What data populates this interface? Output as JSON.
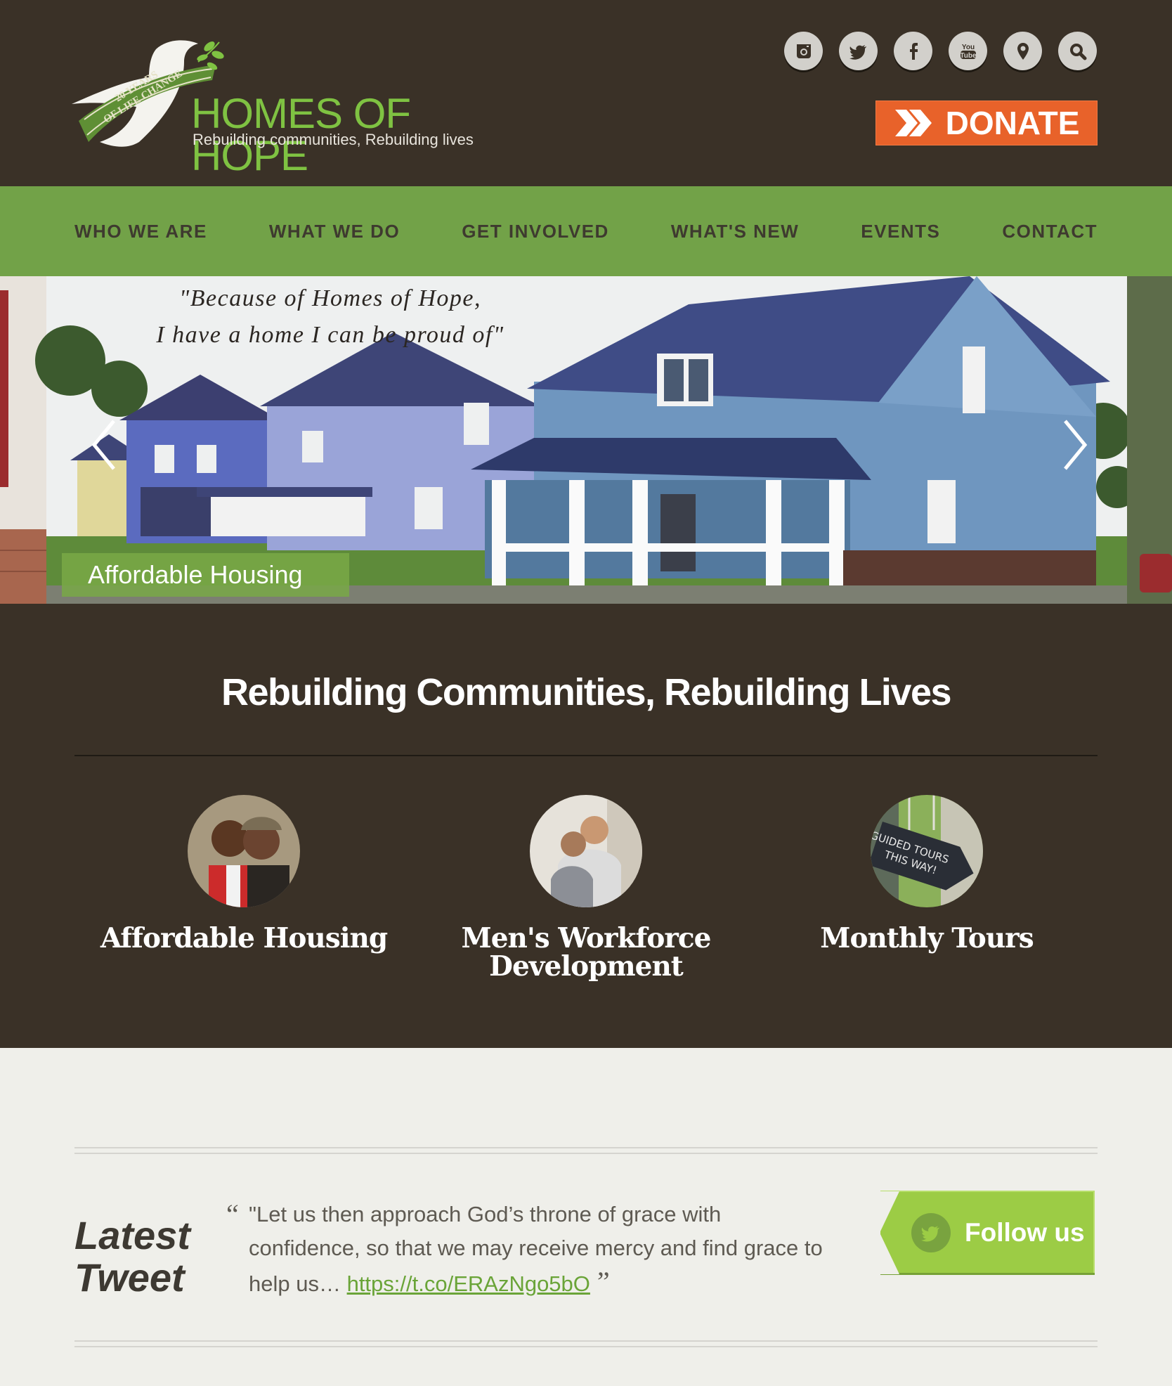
{
  "header": {
    "logo_name": "HOMES OF HOPE",
    "logo_tagline": "Rebuilding communities, Rebuilding lives",
    "logo_badge_line1": "20 YEARS",
    "logo_badge_line2": "OF LIFE CHANGE",
    "social_icons": [
      "instagram-icon",
      "twitter-icon",
      "facebook-icon",
      "youtube-icon",
      "location-pin-icon",
      "search-icon"
    ],
    "donate_label": "DONATE"
  },
  "nav": {
    "items": [
      "WHO WE ARE",
      "WHAT WE DO",
      "GET INVOLVED",
      "WHAT'S NEW",
      "EVENTS",
      "CONTACT"
    ]
  },
  "hero": {
    "quote_line1": "\"Because of Homes of Hope,",
    "quote_line2": "I have a home I can be proud of\"",
    "caption": "Affordable Housing"
  },
  "mission": {
    "title": "Rebuilding Communities, Rebuilding Lives",
    "programs": [
      {
        "label": "Affordable Housing"
      },
      {
        "label_line1": "Men's Workforce",
        "label_line2": "Development"
      },
      {
        "label": "Monthly Tours",
        "sign_text_1": "GUIDED TOURS",
        "sign_text_2": "THIS WAY!"
      }
    ]
  },
  "tweet": {
    "heading_line1": "Latest",
    "heading_line2": "Tweet",
    "open_quote": "“",
    "text": "\"Let us then approach God’s throne of grace with confidence, so that we may receive mercy and find grace to help us… ",
    "link": "https://t.co/ERAzNgo5bO",
    "close_quote": "”",
    "follow_label": "Follow us"
  },
  "colors": {
    "header_bg": "#3a3127",
    "nav_bg": "#72a248",
    "donate_bg": "#e8622a",
    "accent_green": "#7fc242",
    "page_bg": "#efefea"
  }
}
